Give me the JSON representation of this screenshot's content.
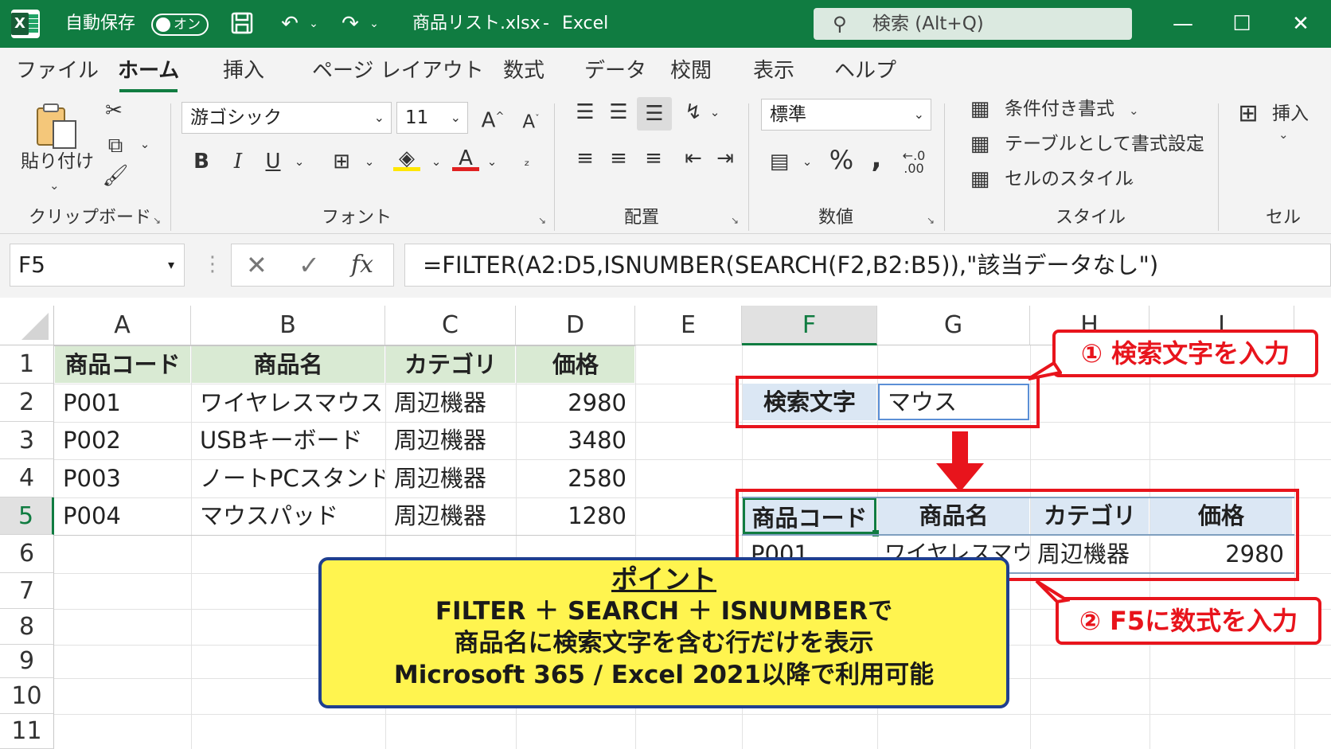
{
  "titlebar": {
    "autosave_label": "自動保存",
    "autosave_state": "オン",
    "filename": "商品リスト.xlsx",
    "separator": "-",
    "app_name": "Excel",
    "search_placeholder": "検索 (Alt+Q)",
    "accent_color": "#107c41"
  },
  "tabs": [
    "ファイル",
    "ホーム",
    "挿入",
    "ページ レイアウト",
    "数式",
    "データ",
    "校閲",
    "表示",
    "ヘルプ"
  ],
  "active_tab": "ホーム",
  "ribbon": {
    "clipboard": {
      "paste_label": "貼り付け",
      "group_label": "クリップボード"
    },
    "font": {
      "font_name": "游ゴシック",
      "font_size": "11",
      "group_label": "フォント"
    },
    "alignment": {
      "group_label": "配置"
    },
    "number": {
      "format": "標準",
      "group_label": "数値"
    },
    "styles": {
      "conditional": "条件付き書式",
      "as_table": "テーブルとして書式設定",
      "cell_styles": "セルのスタイル",
      "group_label": "スタイル"
    },
    "cells": {
      "insert_label": "挿入",
      "group_label": "セル"
    }
  },
  "formula_bar": {
    "name_box": "F5",
    "formula": "=FILTER(A2:D5,ISNUMBER(SEARCH(F2,B2:B5)),\"該当データなし\")"
  },
  "columns": [
    "A",
    "B",
    "C",
    "D",
    "E",
    "F",
    "G",
    "H",
    "I"
  ],
  "rows": [
    "1",
    "2",
    "3",
    "4",
    "5",
    "6",
    "7",
    "8",
    "9",
    "10",
    "11"
  ],
  "source_table": {
    "headers": [
      "商品コード",
      "商品名",
      "カテゴリ",
      "価格"
    ],
    "rows": [
      [
        "P001",
        "ワイヤレスマウス",
        "周辺機器",
        "2980"
      ],
      [
        "P002",
        "USBキーボード",
        "周辺機器",
        "3480"
      ],
      [
        "P003",
        "ノートPCスタンド",
        "周辺機器",
        "2580"
      ],
      [
        "P004",
        "マウスパッド",
        "周辺機器",
        "1280"
      ]
    ]
  },
  "search_box": {
    "label": "検索文字",
    "value": "マウス"
  },
  "result_table": {
    "headers": [
      "商品コード",
      "商品名",
      "カテゴリ",
      "価格"
    ],
    "rows": [
      [
        "P001",
        "ワイヤレスマウス",
        "周辺機器",
        "2980"
      ]
    ]
  },
  "callouts": {
    "step1": "① 検索文字を入力",
    "step2": "② F5に数式を入力"
  },
  "point_box": {
    "title": "ポイント",
    "line1": "FILTER ＋ SEARCH ＋ ISNUMBERで",
    "line2": "商品名に検索文字を含む行だけを表示",
    "line3": "Microsoft 365 / Excel 2021以降で利用可能"
  },
  "colors": {
    "header_fill": "#d9ead3",
    "result_header_fill": "#dbe7f4",
    "callout_red": "#e8141c",
    "point_fill": "#fff44f",
    "point_border": "#1f3f8f"
  }
}
